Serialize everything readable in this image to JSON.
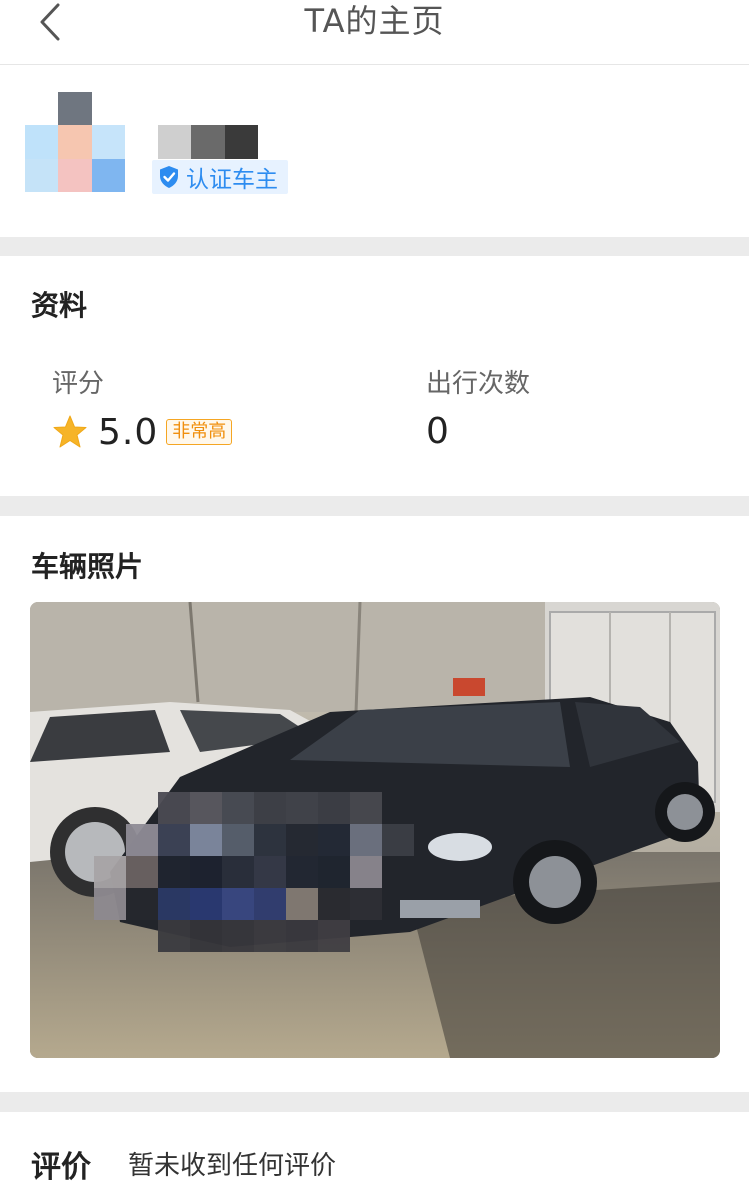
{
  "header": {
    "title": "TA的主页",
    "back_icon": "chevron-left-icon"
  },
  "profile": {
    "avatar_colors": [
      "#ffffff",
      "#6f7680",
      "#ffffff",
      "#bfe2fa",
      "#f6c6b0",
      "#c6e4fa",
      "#c5e3f8",
      "#f4c3c1",
      "#7fb6f0"
    ],
    "name_mosaic_colors": [
      "#cfcfcf",
      "#6a6a6a",
      "#3a3a3a"
    ],
    "badge": {
      "icon": "shield-check-icon",
      "label": "认证车主"
    }
  },
  "info": {
    "title": "资料",
    "rating": {
      "label": "评分",
      "value": "5.0",
      "tag": "非常高",
      "icon": "star-icon"
    },
    "trips": {
      "label": "出行次数",
      "value": "0"
    }
  },
  "vehicle": {
    "title": "车辆照片"
  },
  "reviews": {
    "title": "评价",
    "empty_text": "暂未收到任何评价"
  },
  "colors": {
    "accent_blue": "#2d8cf0",
    "tag_orange": "#f08f0e",
    "star": "#f6b428",
    "divider": "#ebebeb"
  }
}
